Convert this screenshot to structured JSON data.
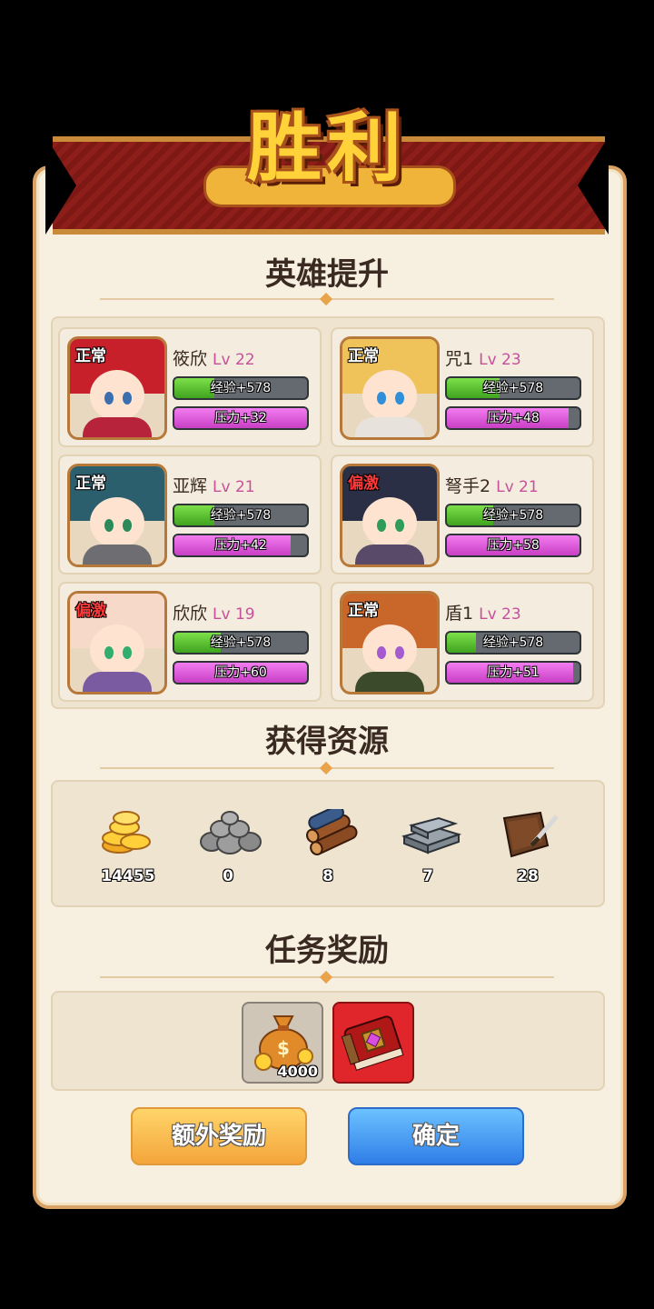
{
  "banner": {
    "title": "胜利"
  },
  "sections": {
    "hero_upgrade": "英雄提升",
    "resources": "获得资源",
    "quest_rewards": "任务奖励"
  },
  "heroes": [
    {
      "name": "筱欣",
      "level": "Lv 22",
      "status": "正常",
      "exp": "经验+578",
      "stress": "压力+32",
      "exp_fill": 0.3,
      "stress_fill": 1.0,
      "hair": "#c8202a",
      "eye": "#3c6fb0",
      "body": "#b6233a"
    },
    {
      "name": "咒1",
      "level": "Lv 23",
      "status": "正常",
      "exp": "经验+578",
      "stress": "压力+48",
      "exp_fill": 0.4,
      "stress_fill": 0.92,
      "hair": "#f0c25a",
      "eye": "#2f8fd8",
      "body": "#e7e2dc"
    },
    {
      "name": "亚辉",
      "level": "Lv 21",
      "status": "正常",
      "exp": "经验+578",
      "stress": "压力+42",
      "exp_fill": 0.3,
      "stress_fill": 0.88,
      "hair": "#2c5f6e",
      "eye": "#2c8a5a",
      "body": "#6e6e72"
    },
    {
      "name": "弩手2",
      "level": "Lv 21",
      "status": "偏激",
      "exp": "经验+578",
      "stress": "压力+58",
      "exp_fill": 0.35,
      "stress_fill": 1.0,
      "hair": "#2a2f45",
      "eye": "#2f9c5a",
      "body": "#5a4a6a"
    },
    {
      "name": "欣欣",
      "level": "Lv 19",
      "status": "偏激",
      "exp": "经验+578",
      "stress": "压力+60",
      "exp_fill": 0.35,
      "stress_fill": 1.0,
      "hair": "#f6d9c8",
      "eye": "#2fae6e",
      "body": "#7a5aa0"
    },
    {
      "name": "盾1",
      "level": "Lv 23",
      "status": "正常",
      "exp": "经验+578",
      "stress": "压力+51",
      "exp_fill": 0.22,
      "stress_fill": 0.95,
      "hair": "#c9672a",
      "eye": "#a45bd0",
      "body": "#3a4a2a"
    }
  ],
  "resources": [
    {
      "icon": "gold-coins-icon",
      "value": "14455"
    },
    {
      "icon": "stone-icon",
      "value": "0"
    },
    {
      "icon": "wood-icon",
      "value": "8"
    },
    {
      "icon": "iron-ingot-icon",
      "value": "7"
    },
    {
      "icon": "leather-icon",
      "value": "28"
    }
  ],
  "rewards": [
    {
      "icon": "money-bag-icon",
      "value": "4000"
    },
    {
      "icon": "red-book-icon",
      "value": ""
    }
  ],
  "buttons": {
    "extra_reward": "额外奖励",
    "confirm": "确定"
  },
  "colors": {
    "panel_bg": "#f7f0e1",
    "ribbon": "#8d1e1a",
    "title_gold": "#ffd23a",
    "level_pink": "#c8509b",
    "exp_green": "#3fa31f",
    "stress_pink": "#c83fc4",
    "btn_orange": "#f4a53b",
    "btn_blue": "#2f7ee8"
  }
}
